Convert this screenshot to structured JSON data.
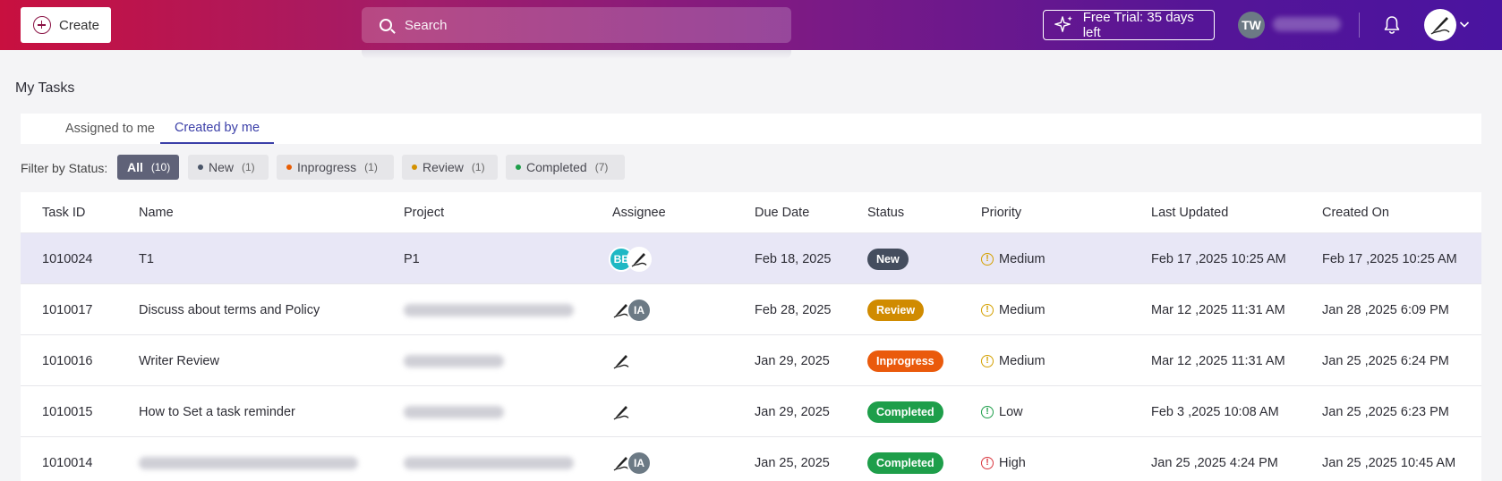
{
  "header": {
    "create_label": "Create",
    "search_placeholder": "Search",
    "trial_label": "Free Trial: 35 days left",
    "user_initials": "TW",
    "icons": [
      "plus-circle-icon",
      "search-icon",
      "sparkle-icon",
      "bell-icon",
      "chevron-down-icon"
    ]
  },
  "page": {
    "title": "My Tasks",
    "tabs": [
      {
        "label": "Assigned to me",
        "active": false
      },
      {
        "label": "Created by me",
        "active": true
      }
    ]
  },
  "filter": {
    "label": "Filter by Status:",
    "chips": [
      {
        "label": "All",
        "count": "(10)",
        "active": true
      },
      {
        "label": "New",
        "count": "(1)",
        "dot": "#4a5568"
      },
      {
        "label": "Inprogress",
        "count": "(1)",
        "dot": "#e85d04"
      },
      {
        "label": "Review",
        "count": "(1)",
        "dot": "#d49100"
      },
      {
        "label": "Completed",
        "count": "(7)",
        "dot": "#1e9e4a"
      }
    ]
  },
  "table": {
    "columns": [
      "Task ID",
      "Name",
      "Project",
      "Assignee",
      "Due Date",
      "Status",
      "Priority",
      "Last Updated",
      "Created On"
    ],
    "rows": [
      {
        "id": "1010024",
        "name": "T1",
        "project": "P1",
        "assignees": [
          {
            "type": "initials",
            "text": "BE",
            "color": "#1fb8c4"
          },
          {
            "type": "pen"
          }
        ],
        "due": "Feb 18, 2025",
        "status": "New",
        "priority": "Medium",
        "updated": "Feb 17 ,2025 10:25 AM",
        "created": "Feb 17 ,2025 10:25 AM",
        "selected": true
      },
      {
        "id": "1010017",
        "name": "Discuss about terms and Policy",
        "project": "",
        "assignees": [
          {
            "type": "pen"
          },
          {
            "type": "initials",
            "text": "IA",
            "color": "#6c7a85"
          }
        ],
        "due": "Feb 28, 2025",
        "status": "Review",
        "priority": "Medium",
        "updated": "Mar 12 ,2025 11:31 AM",
        "created": "Jan 28 ,2025 6:09 PM"
      },
      {
        "id": "1010016",
        "name": "Writer Review",
        "project": "",
        "assignees": [
          {
            "type": "pen"
          }
        ],
        "due": "Jan 29, 2025",
        "status": "Inprogress",
        "priority": "Medium",
        "updated": "Mar 12 ,2025 11:31 AM",
        "created": "Jan 25 ,2025 6:24 PM"
      },
      {
        "id": "1010015",
        "name": "How to Set a task reminder",
        "project": "",
        "assignees": [
          {
            "type": "pen"
          }
        ],
        "due": "Jan 29, 2025",
        "status": "Completed",
        "priority": "Low",
        "updated": "Feb 3 ,2025 10:08 AM",
        "created": "Jan 25 ,2025 6:23 PM"
      },
      {
        "id": "1010014",
        "name": "",
        "project": "",
        "assignees": [
          {
            "type": "pen"
          },
          {
            "type": "initials",
            "text": "IA",
            "color": "#6c7a85"
          }
        ],
        "due": "Jan 25, 2025",
        "status": "Completed",
        "priority": "High",
        "updated": "Jan 25 ,2025 4:24 PM",
        "created": "Jan 25 ,2025 10:45 AM"
      }
    ]
  },
  "colors": {
    "status": {
      "New": "#444d5e",
      "Review": "#d08b00",
      "Inprogress": "#ea5a0c",
      "Completed": "#1e9e4a"
    },
    "priority": {
      "Medium": "#d4a000",
      "Low": "#1e9e4a",
      "High": "#d9363e"
    },
    "accent": "#3b3fa8"
  }
}
